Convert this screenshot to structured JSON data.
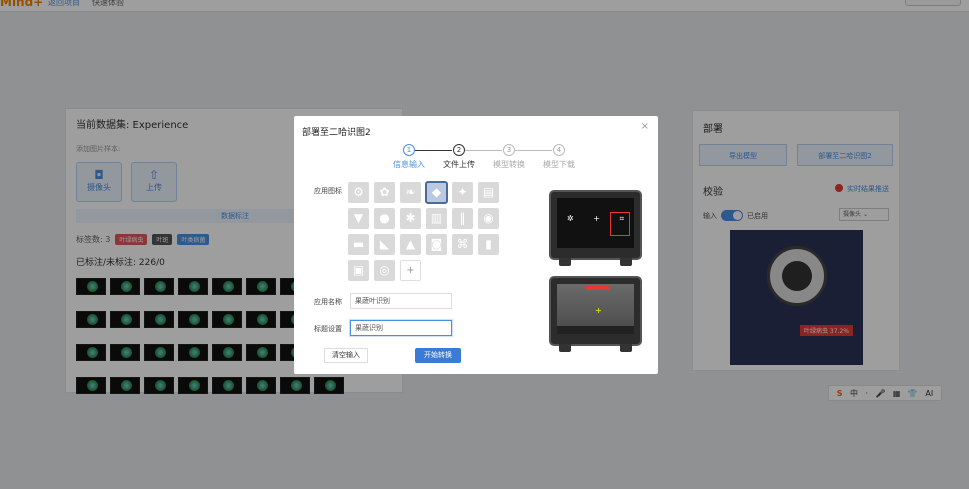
{
  "topbar": {
    "logo": "Mind+",
    "crumb1": "返回项目",
    "crumb2": "快速体验"
  },
  "left": {
    "title": "当前数据集: Experience",
    "add_label": "添加图片样本:",
    "camera_btn": "摄像头",
    "upload_btn": "上传",
    "annotate_btn": "数据标注",
    "tag_count": "标签数: 3",
    "tags": [
      {
        "text": "叶绿病虫",
        "color": "#e05a5a"
      },
      {
        "text": "叶斑",
        "color": "#555555"
      },
      {
        "text": "叶类病菌",
        "color": "#4a90e2"
      }
    ],
    "label_count": "已标注/未标注: 226/0"
  },
  "right": {
    "title": "部署",
    "export_btn": "导出模型",
    "deploy_btn": "部署至二哈识图2",
    "verify_title": "校验",
    "push_label": "实时结果推送",
    "input_label": "输入",
    "enabled_label": "已启用",
    "camera_select": "摄像头",
    "detection": "叶绿病虫 37.2%"
  },
  "modal": {
    "title": "部署至二哈识图2",
    "close": "×",
    "steps": [
      {
        "num": "1",
        "label": "信息输入"
      },
      {
        "num": "2",
        "label": "文件上传"
      },
      {
        "num": "3",
        "label": "模型转换"
      },
      {
        "num": "4",
        "label": "模型下载"
      }
    ],
    "icon_label": "应用图标",
    "icons": [
      "gear-icon",
      "flower-icon",
      "leaf-icon",
      "mango-icon",
      "paw-icon",
      "book-icon",
      "cup-icon",
      "fruit-icon",
      "bug-icon",
      "trash-icon",
      "bottle-icon",
      "mouse-icon",
      "desk-icon",
      "ruler-icon",
      "shirt-icon",
      "camera-icon",
      "chip-icon",
      "bottles-icon",
      "car-icon",
      "reel-icon"
    ],
    "add_icon": "+",
    "app_name_label": "应用名称",
    "app_name_value": "果蔬叶识别",
    "title_label": "标题设置",
    "title_value": "果蔬识别",
    "clear_btn": "清空输入",
    "start_btn": "开始转换"
  },
  "ime": {
    "items": [
      "S",
      "中",
      "·",
      "🎤",
      "▦",
      "👕",
      "AI"
    ]
  }
}
